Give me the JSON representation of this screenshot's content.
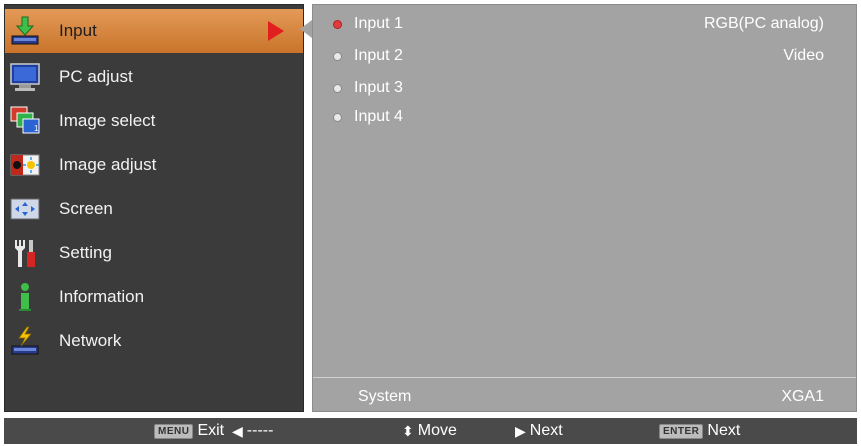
{
  "menu": {
    "items": [
      {
        "label": "Input",
        "icon": "input-icon",
        "selected": true
      },
      {
        "label": "PC adjust",
        "icon": "pc-adjust-icon"
      },
      {
        "label": "Image select",
        "icon": "image-select-icon"
      },
      {
        "label": "Image adjust",
        "icon": "image-adjust-icon"
      },
      {
        "label": "Screen",
        "icon": "screen-icon"
      },
      {
        "label": "Setting",
        "icon": "setting-icon"
      },
      {
        "label": "Information",
        "icon": "information-icon"
      },
      {
        "label": "Network",
        "icon": "network-icon"
      }
    ]
  },
  "inputs": [
    {
      "label": "Input 1",
      "value": "RGB(PC analog)",
      "active": true
    },
    {
      "label": "Input 2",
      "value": "Video"
    },
    {
      "label": "Input 3",
      "value": ""
    },
    {
      "label": "Input 4",
      "value": ""
    }
  ],
  "system": {
    "label": "System",
    "value": "XGA1"
  },
  "footer": {
    "exit_key": "MENU",
    "exit_label": "Exit",
    "back_label": "-----",
    "move_label": "Move",
    "next_label": "Next",
    "enter_key": "ENTER",
    "enter_label": "Next"
  },
  "colors": {
    "selected": "#d9873f",
    "accent_arrow": "#e31e1e",
    "panel": "#a3a3a3",
    "menu": "#3b3b3b"
  }
}
